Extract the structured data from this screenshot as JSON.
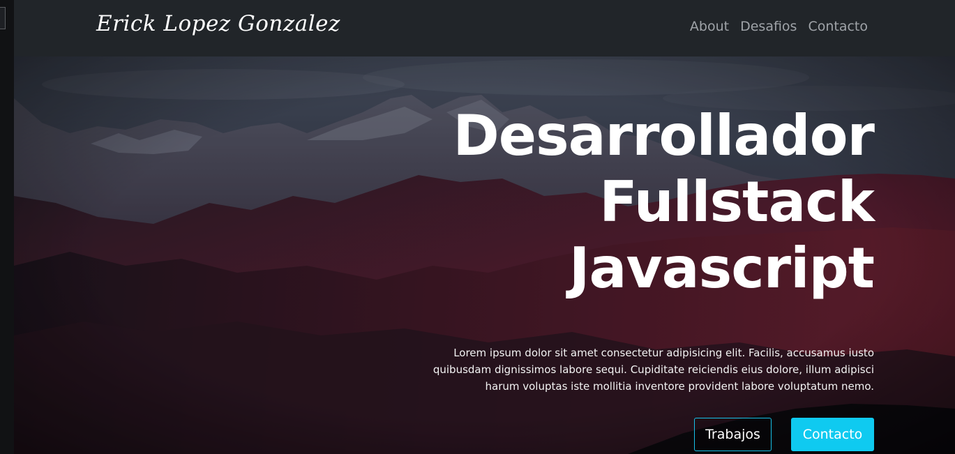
{
  "brand": {
    "name": "Erick Lopez Gonzalez"
  },
  "nav": {
    "items": [
      {
        "label": "About"
      },
      {
        "label": "Desafios"
      },
      {
        "label": "Contacto"
      }
    ]
  },
  "hero": {
    "title_lines": [
      "Desarrollador",
      "Fullstack",
      "Javascript"
    ],
    "description": "Lorem ipsum dolor sit amet consectetur adipisicing elit. Facilis, accusamus iusto quibusdam dignissimos labore sequi. Cupiditate reiciendis eius dolore, illum adipisci harum voluptas iste mollitia inventore provident labore voluptatum nemo.",
    "buttons": {
      "primary_label": "Trabajos",
      "secondary_label": "Contacto"
    }
  },
  "colors": {
    "navbar_bg": "#212529",
    "accent": "#0fcaf0"
  }
}
